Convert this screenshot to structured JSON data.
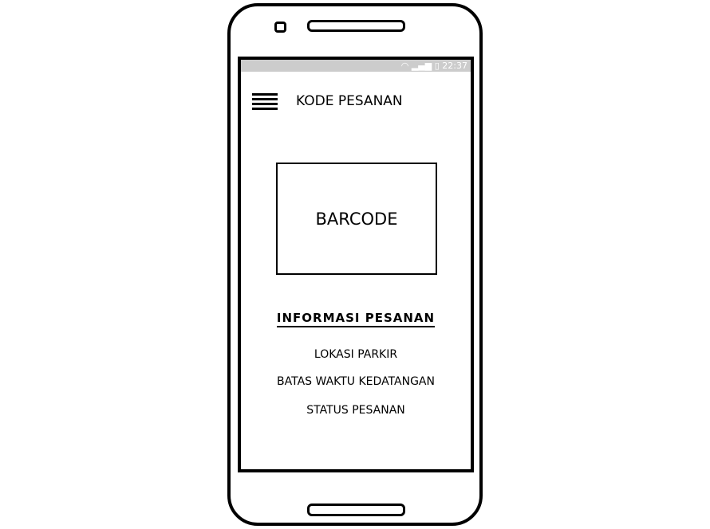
{
  "status_bar": {
    "time": "22:37",
    "icons": [
      "wifi-icon",
      "signal-icon",
      "battery-icon"
    ]
  },
  "header": {
    "title": "KODE PESANAN",
    "menu_icon": "hamburger-icon"
  },
  "barcode": {
    "label": "BARCODE"
  },
  "info": {
    "heading": "INFORMASI PESANAN",
    "items": [
      "LOKASI PARKIR",
      "BATAS WAKTU KEDATANGAN",
      "STATUS PESANAN"
    ]
  }
}
